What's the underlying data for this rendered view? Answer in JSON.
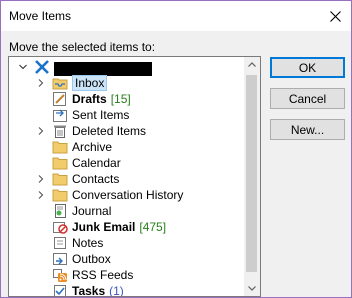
{
  "window": {
    "title": "Move Items"
  },
  "prompt": "Move the selected items to:",
  "buttons": {
    "ok": "OK",
    "cancel": "Cancel",
    "new": "New..."
  },
  "tree": {
    "account": {
      "icon": "exchange-account-icon",
      "redacted": true
    },
    "items": [
      {
        "label": "Inbox",
        "icon": "inbox-folder-icon",
        "expandable": true,
        "bold": false,
        "count": "",
        "selected": true
      },
      {
        "label": "Drafts",
        "icon": "drafts-folder-icon",
        "expandable": false,
        "bold": true,
        "count": "[15]"
      },
      {
        "label": "Sent Items",
        "icon": "sent-items-icon",
        "expandable": false,
        "bold": false,
        "count": ""
      },
      {
        "label": "Deleted Items",
        "icon": "deleted-items-icon",
        "expandable": true,
        "bold": false,
        "count": ""
      },
      {
        "label": "Archive",
        "icon": "folder-icon",
        "expandable": false,
        "bold": false,
        "count": ""
      },
      {
        "label": "Calendar",
        "icon": "calendar-icon",
        "expandable": false,
        "bold": false,
        "count": ""
      },
      {
        "label": "Contacts",
        "icon": "contacts-icon",
        "expandable": true,
        "bold": false,
        "count": ""
      },
      {
        "label": "Conversation History",
        "icon": "folder-icon",
        "expandable": true,
        "bold": false,
        "count": ""
      },
      {
        "label": "Journal",
        "icon": "journal-icon",
        "expandable": false,
        "bold": false,
        "count": ""
      },
      {
        "label": "Junk Email",
        "icon": "junk-email-icon",
        "expandable": false,
        "bold": true,
        "count": "[475]"
      },
      {
        "label": "Notes",
        "icon": "notes-icon",
        "expandable": false,
        "bold": false,
        "count": ""
      },
      {
        "label": "Outbox",
        "icon": "outbox-icon",
        "expandable": false,
        "bold": false,
        "count": ""
      },
      {
        "label": "RSS Feeds",
        "icon": "rss-feed-icon",
        "expandable": false,
        "bold": false,
        "count": ""
      },
      {
        "label": "Tasks",
        "icon": "tasks-icon",
        "expandable": false,
        "bold": true,
        "count": "(1)"
      }
    ]
  }
}
